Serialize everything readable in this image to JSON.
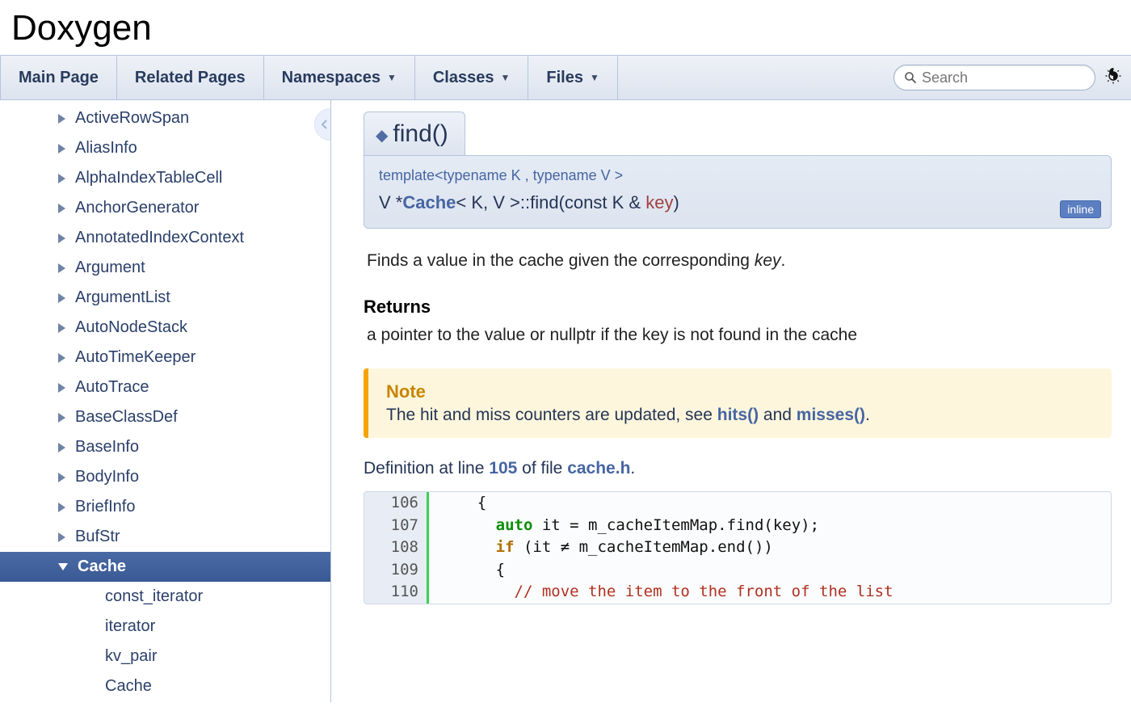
{
  "project": {
    "name": "Doxygen"
  },
  "tabs": [
    {
      "label": "Main Page",
      "dropdown": false
    },
    {
      "label": "Related Pages",
      "dropdown": false
    },
    {
      "label": "Namespaces",
      "dropdown": true
    },
    {
      "label": "Classes",
      "dropdown": true
    },
    {
      "label": "Files",
      "dropdown": true
    }
  ],
  "search": {
    "placeholder": "Search"
  },
  "tree": {
    "items": [
      {
        "label": "ActiveRowSpan",
        "expandable": true
      },
      {
        "label": "AliasInfo",
        "expandable": true
      },
      {
        "label": "AlphaIndexTableCell",
        "expandable": true
      },
      {
        "label": "AnchorGenerator",
        "expandable": true
      },
      {
        "label": "AnnotatedIndexContext",
        "expandable": true
      },
      {
        "label": "Argument",
        "expandable": true
      },
      {
        "label": "ArgumentList",
        "expandable": true
      },
      {
        "label": "AutoNodeStack",
        "expandable": true
      },
      {
        "label": "AutoTimeKeeper",
        "expandable": true
      },
      {
        "label": "AutoTrace",
        "expandable": true
      },
      {
        "label": "BaseClassDef",
        "expandable": true
      },
      {
        "label": "BaseInfo",
        "expandable": true
      },
      {
        "label": "BodyInfo",
        "expandable": true
      },
      {
        "label": "BriefInfo",
        "expandable": true
      },
      {
        "label": "BufStr",
        "expandable": true
      }
    ],
    "selected": {
      "label": "Cache",
      "expandable": true
    },
    "children": [
      {
        "label": "const_iterator"
      },
      {
        "label": "iterator"
      },
      {
        "label": "kv_pair"
      },
      {
        "label": "Cache"
      }
    ]
  },
  "member": {
    "title": "find()",
    "tparams": "template<typename K , typename V >",
    "return_type": "V * ",
    "class_link": "Cache",
    "class_suffix": "< K, V >::find",
    "params_open": " ( ",
    "param_type": "const K & ",
    "param_name": "key",
    "params_close": " )",
    "inline_badge": "inline",
    "brief_pre": "Finds a value in the cache given the corresponding ",
    "brief_key": "key",
    "brief_post": ".",
    "returns_label": "Returns",
    "returns_text": "a pointer to the value or nullptr if the key is not found in the cache",
    "note": {
      "title": "Note",
      "text_pre": "The hit and miss counters are updated, see ",
      "link1": "hits()",
      "mid": " and ",
      "link2": "misses()",
      "post": "."
    },
    "def": {
      "pre": "Definition at line ",
      "line": "105",
      "mid": " of file ",
      "file": "cache.h",
      "post": "."
    },
    "code": [
      {
        "no": "106",
        "text": "    {"
      },
      {
        "no": "107",
        "kw": "auto",
        "text_after": " it = m_cacheItemMap.find(key);"
      },
      {
        "no": "108",
        "kwflow": "if",
        "text_after": " (it ≠ m_cacheItemMap.end())"
      },
      {
        "no": "109",
        "text": "      {"
      },
      {
        "no": "110",
        "comment": "// move the item to the front of the list"
      }
    ]
  }
}
